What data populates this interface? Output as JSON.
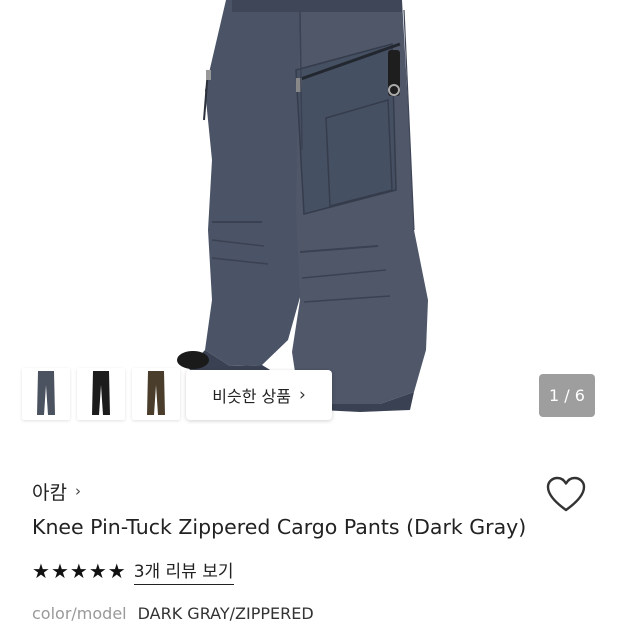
{
  "gallery": {
    "thumbnails": [
      {
        "name": "dark-gray",
        "color": "#4b5260"
      },
      {
        "name": "black",
        "color": "#1c1c1c"
      },
      {
        "name": "brown",
        "color": "#4a3d2c"
      }
    ],
    "similar_button": {
      "label": "비슷한 상품",
      "icon": "chevron-right-icon"
    },
    "page_counter": "1 / 6"
  },
  "product": {
    "brand": "아캄",
    "title": "Knee Pin-Tuck Zippered Cargo Pants (Dark Gray)",
    "rating": {
      "stars": 5,
      "max": 5
    },
    "review_link": "3개 리뷰 보기",
    "option": {
      "label": "color/model",
      "value": "DARK GRAY/ZIPPERED"
    }
  },
  "colors": {
    "pants": "#4b5366",
    "pants_shadow": "#3a4152",
    "text": "#222222",
    "muted": "#999999"
  }
}
